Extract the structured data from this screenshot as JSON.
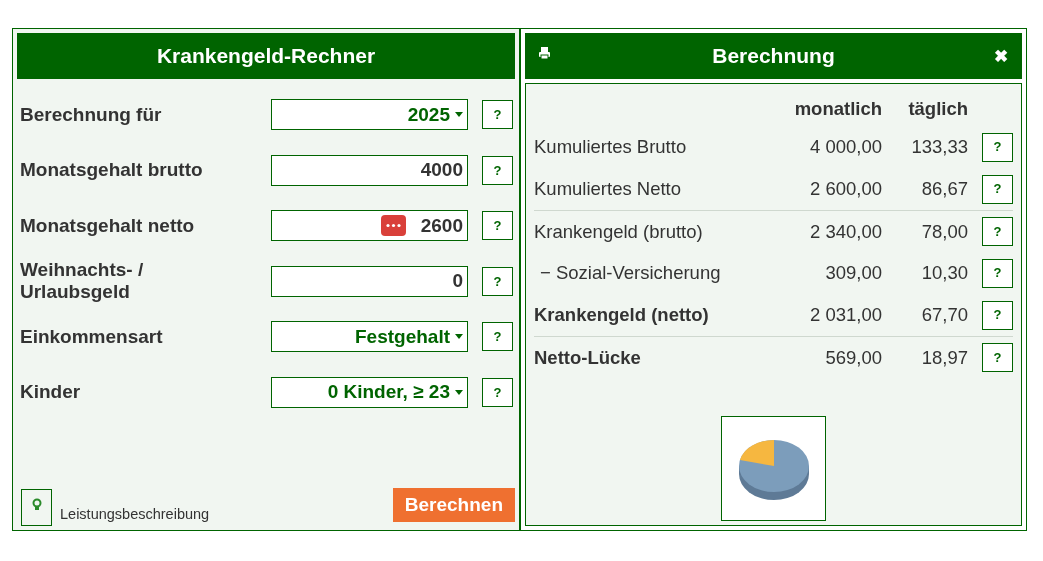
{
  "calculator": {
    "title": "Krankengeld-Rechner",
    "fields": [
      {
        "label": "Berechnung für",
        "kind": "select",
        "value": "2025",
        "help": "?"
      },
      {
        "label": "Monatsgehalt brutto",
        "kind": "input",
        "value": "4000",
        "help": "?"
      },
      {
        "label": "Monatsgehalt netto",
        "kind": "input",
        "value": "2600",
        "help": "?",
        "overlay_badge": true
      },
      {
        "label": "Weihnachts- / Urlaubsgeld",
        "kind": "input",
        "value": "0",
        "help": "?"
      },
      {
        "label": "Einkommensart",
        "kind": "select",
        "value": "Festgehalt",
        "help": "?"
      },
      {
        "label": "Kinder",
        "kind": "select",
        "value": "0 Kinder, ≥ 23",
        "help": "?"
      }
    ],
    "description_link": "Leistungsbeschreibung",
    "submit": "Berechnen"
  },
  "result": {
    "title": "Berechnung",
    "close": "✖",
    "columns": [
      "monatlich",
      "täglich"
    ],
    "rows": [
      {
        "label": "Kumuliertes Brutto",
        "monthly": "4 000,00",
        "daily": "133,33",
        "help": "?",
        "kind": "normal",
        "separator_above": false
      },
      {
        "label": "Kumuliertes Netto",
        "monthly": "2 600,00",
        "daily": "86,67",
        "help": "?",
        "kind": "normal",
        "separator_above": false
      },
      {
        "label": "Krankengeld (brutto)",
        "monthly": "2 340,00",
        "daily": "78,00",
        "help": "?",
        "kind": "normal",
        "separator_above": true
      },
      {
        "label": "− Sozial-Versicherung",
        "monthly": "309,00",
        "daily": "10,30",
        "help": "?",
        "kind": "sub",
        "separator_above": false
      },
      {
        "label": "Krankengeld (netto)",
        "monthly": "2 031,00",
        "daily": "67,70",
        "help": "?",
        "kind": "bold",
        "separator_above": false
      },
      {
        "label": "Netto-Lücke",
        "monthly": "569,00",
        "daily": "18,97",
        "help": "?",
        "kind": "bold",
        "separator_above": true
      }
    ]
  }
}
